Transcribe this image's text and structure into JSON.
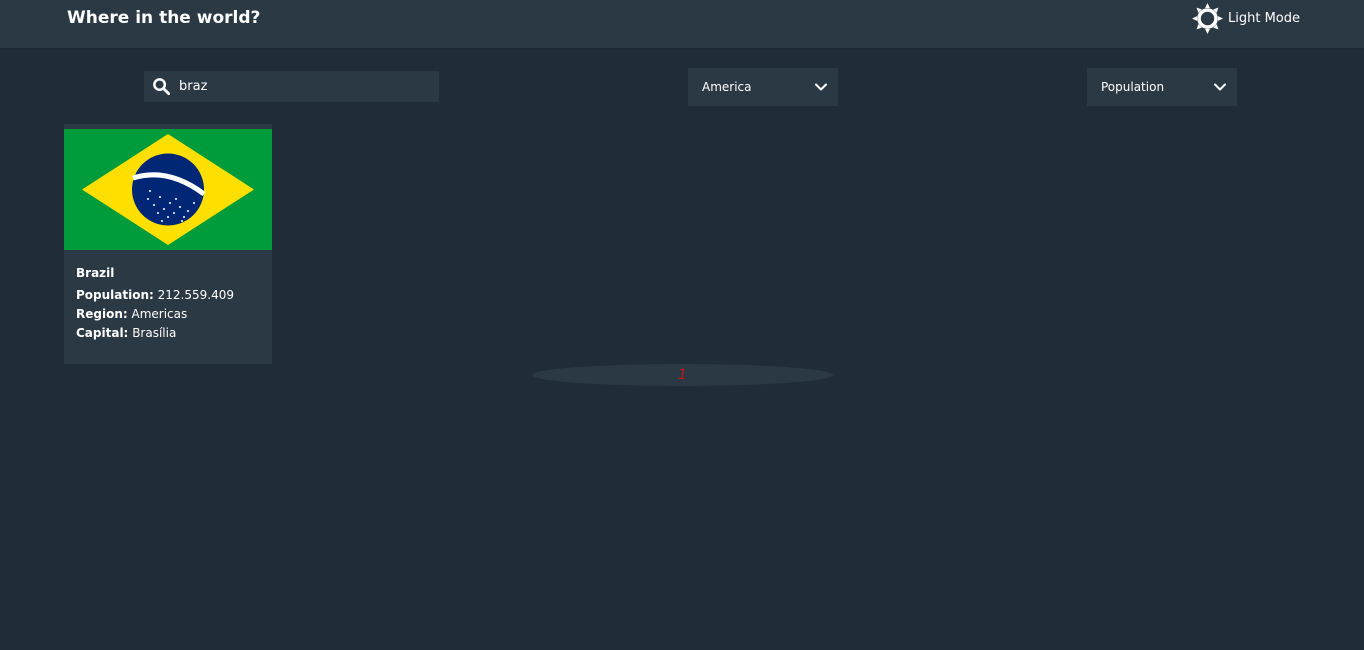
{
  "header": {
    "title": "Where in the world?",
    "mode_label": "Light Mode"
  },
  "search": {
    "value": "braz",
    "icon": "search-icon"
  },
  "filters": {
    "region": "America",
    "sort": "Population"
  },
  "countries": [
    {
      "name": "Brazil",
      "population_label": "Population:",
      "population": "212.559.409",
      "region_label": "Region:",
      "region": "Americas",
      "capital_label": "Capital:",
      "capital": "Brasília",
      "flag": "brazil-flag"
    }
  ],
  "pagination": {
    "pages": [
      "1"
    ],
    "current": "1"
  },
  "colors": {
    "background": "#202c37",
    "surface": "#2b3945",
    "text": "#ffffff",
    "page_number": "#c0151b"
  }
}
